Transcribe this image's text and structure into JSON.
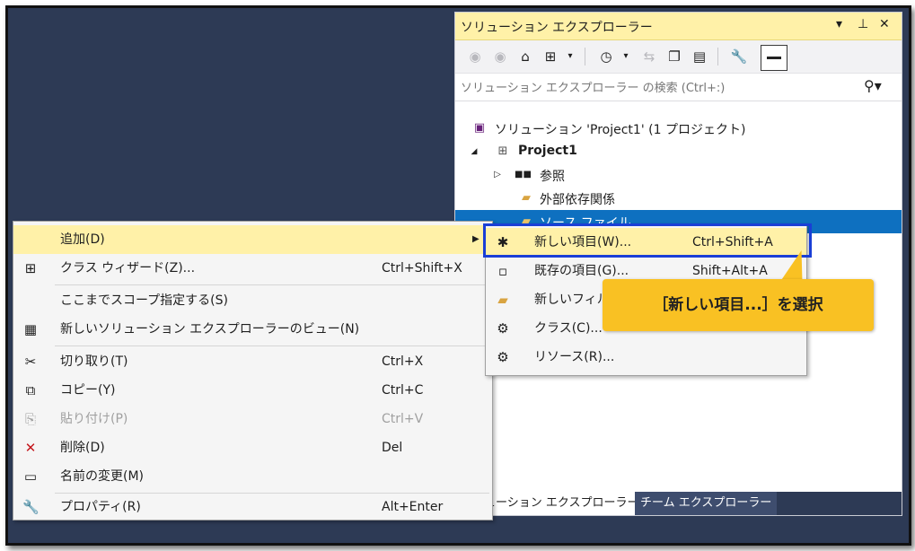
{
  "solution_explorer": {
    "title": "ソリューション エクスプローラー",
    "controls": {
      "dropdown": "▾",
      "pin": "⊥",
      "close": "✕"
    },
    "toolbar": {
      "icons": [
        "back-icon",
        "forward-icon",
        "home-icon",
        "switch-views-icon",
        "history-icon",
        "sync-icon",
        "collapse-all-icon",
        "show-all-files-icon",
        "properties-icon",
        "preview-icon"
      ]
    },
    "search": {
      "placeholder": "ソリューション エクスプローラー の検索 (Ctrl+:)"
    },
    "tree": [
      {
        "label": "ソリューション 'Project1' (1 プロジェクト)",
        "icon": "solution-icon"
      },
      {
        "label": "Project1",
        "icon": "project-icon",
        "expander": "◢"
      },
      {
        "label": "参照",
        "icon": "references-icon",
        "expander": "▷"
      },
      {
        "label": "外部依存関係",
        "icon": "external-deps-icon"
      },
      {
        "label": "ソース ファイル",
        "icon": "folder-icon",
        "selected": true
      }
    ],
    "tabs": [
      {
        "label": "ソリューション エクスプローラー",
        "active": true
      },
      {
        "label": "チーム エクスプローラー",
        "active": false
      }
    ]
  },
  "context_menu": {
    "items": [
      {
        "label": "追加(D)",
        "shortcut": "",
        "icon": "",
        "submenu": true,
        "highlighted": true
      },
      {
        "label": "クラス ウィザード(Z)...",
        "shortcut": "Ctrl+Shift+X",
        "icon": "class-wizard-icon"
      },
      {
        "label": "ここまでスコープ指定する(S)",
        "shortcut": "",
        "icon": ""
      },
      {
        "label": "新しいソリューション エクスプローラーのビュー(N)",
        "shortcut": "",
        "icon": "new-view-icon"
      },
      {
        "label": "切り取り(T)",
        "shortcut": "Ctrl+X",
        "icon": "cut-icon"
      },
      {
        "label": "コピー(Y)",
        "shortcut": "Ctrl+C",
        "icon": "copy-icon"
      },
      {
        "label": "貼り付け(P)",
        "shortcut": "Ctrl+V",
        "icon": "paste-icon",
        "disabled": true
      },
      {
        "label": "削除(D)",
        "shortcut": "Del",
        "icon": "delete-icon"
      },
      {
        "label": "名前の変更(M)",
        "shortcut": "",
        "icon": "rename-icon"
      },
      {
        "label": "プロパティ(R)",
        "shortcut": "Alt+Enter",
        "icon": "wrench-icon"
      }
    ]
  },
  "submenu": {
    "items": [
      {
        "label": "新しい項目(W)...",
        "shortcut": "Ctrl+Shift+A",
        "icon": "new-item-icon",
        "highlighted": true
      },
      {
        "label": "既存の項目(G)...",
        "shortcut": "Shift+Alt+A",
        "icon": "existing-item-icon"
      },
      {
        "label": "新しいフィル",
        "shortcut": "",
        "icon": "new-filter-icon"
      },
      {
        "label": "クラス(C)...",
        "shortcut": "",
        "icon": "class-icon"
      },
      {
        "label": "リソース(R)...",
        "shortcut": "",
        "icon": "resource-icon"
      }
    ]
  },
  "callout": {
    "text": "［新しい項目...］を選択"
  },
  "colors": {
    "background": "#2d3a55",
    "highlight": "#fff1a8",
    "selection": "#0e70c0",
    "callout": "#f9c123",
    "box": "#1a3fd6"
  }
}
